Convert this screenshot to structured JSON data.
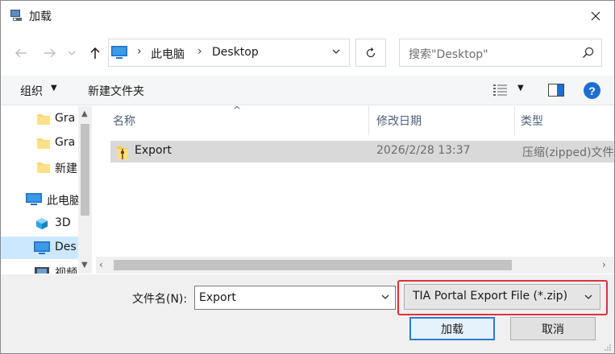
{
  "window": {
    "title": "加载"
  },
  "nav": {
    "breadcrumbs": [
      "此电脑",
      "Desktop"
    ],
    "search_placeholder": "搜索\"Desktop\""
  },
  "toolbar": {
    "organize": "组织",
    "new_folder": "新建文件夹"
  },
  "sidebar": {
    "items": [
      {
        "label": "Gra",
        "icon": "folder-icon"
      },
      {
        "label": "Gra",
        "icon": "folder-icon"
      },
      {
        "label": "新建",
        "icon": "folder-icon"
      },
      {
        "label": "此电脑",
        "icon": "pc-icon"
      },
      {
        "label": "3D",
        "icon": "3d-objects-icon"
      },
      {
        "label": "Des",
        "icon": "desktop-icon",
        "selected": true
      },
      {
        "label": "视频",
        "icon": "video-icon"
      }
    ]
  },
  "filelist": {
    "columns": {
      "name": "名称",
      "date": "修改日期",
      "type": "类型"
    },
    "rows": [
      {
        "name": "Export",
        "date": "2026/2/28 13:37",
        "type": "压缩(zipped)文件夹"
      }
    ]
  },
  "bottom": {
    "filename_label": "文件名(N):",
    "filename_value": "Export",
    "filetype_selected": "TIA Portal Export File (*.zip)",
    "load_button": "加载",
    "cancel_button": "取消"
  },
  "colors": {
    "accent": "#1c6fd1",
    "highlight": "#e0313a",
    "selection": "#cce8ff"
  }
}
